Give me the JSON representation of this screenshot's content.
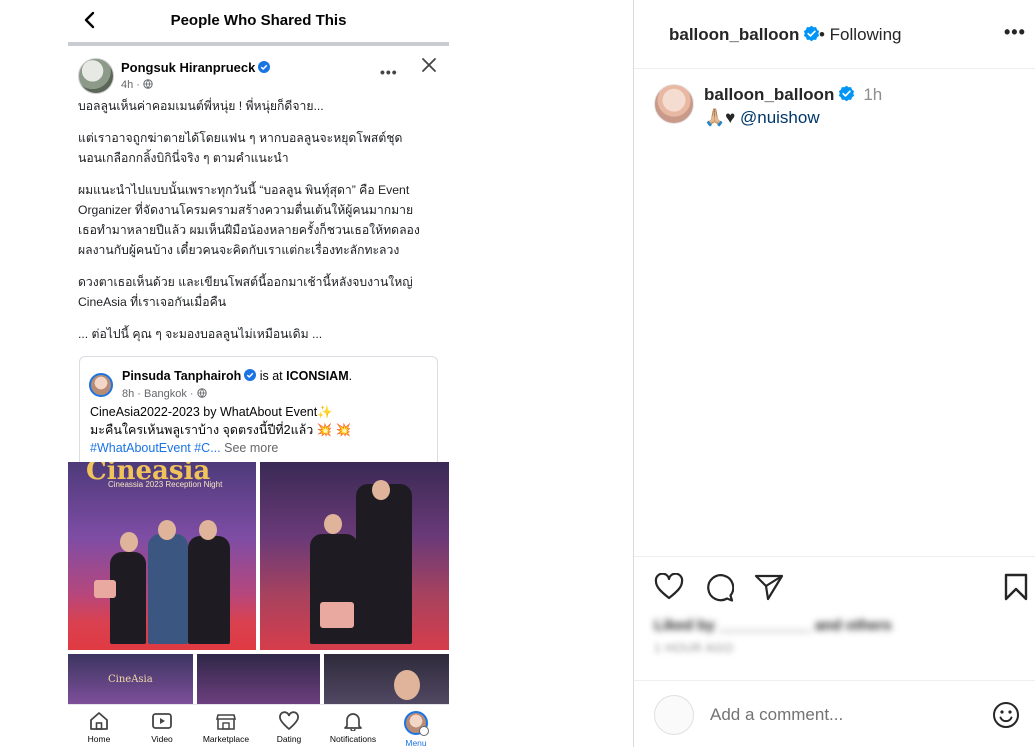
{
  "share_dialog": {
    "title": "People Who Shared This"
  },
  "post": {
    "author": "Pongsuk Hiranprueck",
    "time": "4h · ",
    "more": "•••",
    "paragraphs": [
      "บอลลูนเห็นค่าคอมเมนต์พี่หนุ่ย ! พี่หนุ่ยก็ดีจาย...",
      "แต่เราอาจถูกฆ่าตายได้โดยแฟน ๆ หากบอลลูนจะหยุดโพสต์ชุด\nนอนเกลือกกลิ้งบิกินี่จริง ๆ ตามคำแนะนำ",
      "ผมแนะนำไปแบบนั้นเพราะทุกวันนี้ “บอลลูน พินทุ์สุดา” คือ Event\nOrganizer ที่จัดงานโครมครามสร้างความตื่นเต้นให้ผู้คนมากมาย\nเธอทำมาหลายปีแล้ว ผมเห็นฝีมือน้องหลายครั้งก็ชวนเธอให้ทดลอง\nผลงานกับผู้คนบ้าง เดี๋ยวคนจะคิดกับเราแต่กะเรื่องทะลักทะลวง",
      "ดวงตาเธอเห็นด้วย และเขียนโพสต์นี้ออกมาเช้านี้หลังจบงานใหญ่\nCineAsia ที่เราเจอกันเมื่อคืน",
      " ... ต่อไปนี้ คุณ ๆ จะมองบอลลูนไม่เหมือนเดิม ..."
    ]
  },
  "shared_post": {
    "author": "Pinsuda Tanphairoh",
    "is_at": " is at ",
    "place": "ICONSIAM",
    "period": ".",
    "meta": "8h · Bangkok · ",
    "line1": "CineAsia2022-2023 by WhatAbout Event✨",
    "line2": "มะคืนใครเห้นพลูเราบ้าง จุดตรงนี้ปีที่2แล้ว 💥 💥",
    "hashtags": "#WhatAboutEvent #C...",
    "see_more": " See more",
    "photo_banner": "Cineasia",
    "photo_sub": "Cineassia 2023 Reception Night",
    "photo_small": "CineAsia"
  },
  "bottom_nav": [
    {
      "label": "Home",
      "icon": "home-icon"
    },
    {
      "label": "Video",
      "icon": "video-icon"
    },
    {
      "label": "Marketplace",
      "icon": "marketplace-icon"
    },
    {
      "label": "Dating",
      "icon": "dating-icon"
    },
    {
      "label": "Notifications",
      "icon": "bell-icon"
    },
    {
      "label": "Menu",
      "icon": "menu-avatar-icon"
    }
  ],
  "ig": {
    "username": "balloon_balloon",
    "following_label": "• Following",
    "more": "•••",
    "caption_user": "balloon_balloon",
    "caption_time": "1h",
    "caption_emoji": "🙏🏼♥ ",
    "caption_mention": "@nuishow",
    "likes_text": "Liked by ___________ and others",
    "time_ago": "1 HOUR AGO",
    "comment_placeholder": "Add a comment..."
  },
  "colors": {
    "verified_blue": "#0095f6",
    "fb_blue": "#1b74e4",
    "text": "#262626"
  }
}
